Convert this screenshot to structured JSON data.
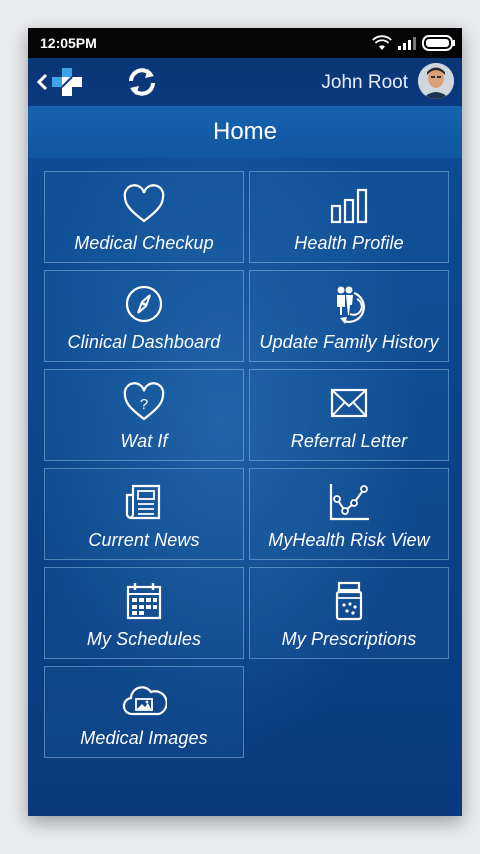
{
  "status": {
    "time": "12:05PM",
    "icons": [
      "wifi-icon",
      "signal-icon",
      "battery-icon"
    ]
  },
  "appbar": {
    "user_name": "John Root",
    "back_icon": "back-chevron-icon",
    "logo_icon": "medical-cross-logo",
    "sync_icon": "sync-icon"
  },
  "header": {
    "title": "Home"
  },
  "tiles": [
    {
      "label": "Medical Checkup",
      "icon": "heart-icon"
    },
    {
      "label": "Health Profile",
      "icon": "bar-chart-icon"
    },
    {
      "label": "Clinical Dashboard",
      "icon": "compass-icon"
    },
    {
      "label": "Update Family History",
      "icon": "family-history-icon"
    },
    {
      "label": "Wat If",
      "icon": "heart-question-icon"
    },
    {
      "label": "Referral Letter",
      "icon": "envelope-icon"
    },
    {
      "label": "Current News",
      "icon": "newspaper-icon"
    },
    {
      "label": "MyHealth Risk View",
      "icon": "line-chart-icon"
    },
    {
      "label": "My Schedules",
      "icon": "calendar-icon"
    },
    {
      "label": "My Prescriptions",
      "icon": "pill-jar-icon"
    },
    {
      "label": "Medical Images",
      "icon": "cloud-image-icon"
    }
  ],
  "colors": {
    "background": "#0b4187",
    "header": "#1763b0",
    "tile_border": "#a0c8f0",
    "text": "#ffffff"
  }
}
